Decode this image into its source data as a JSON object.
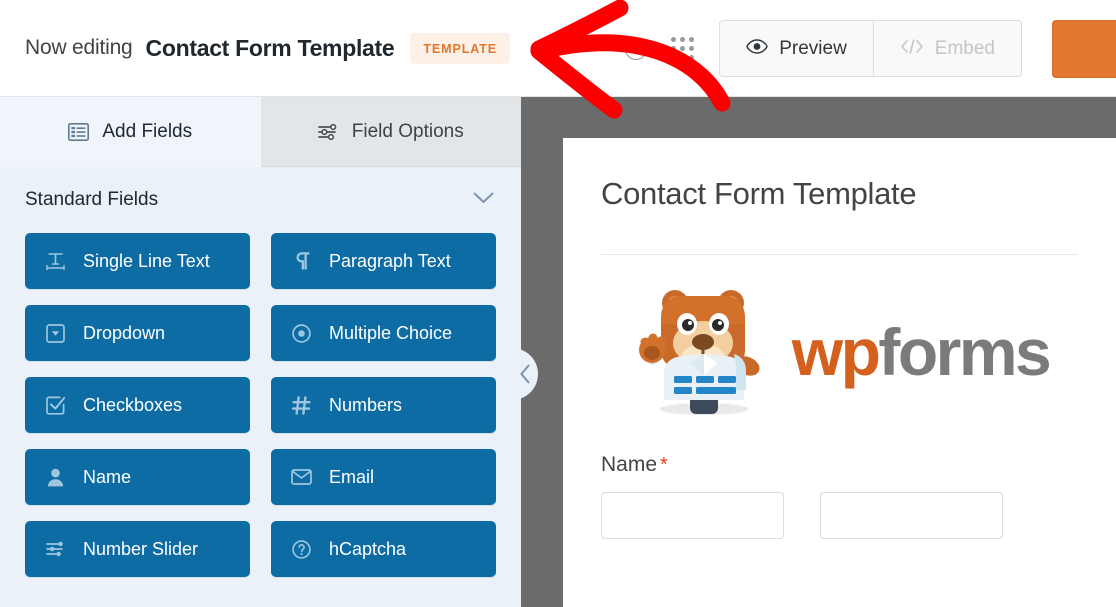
{
  "header": {
    "now_editing_label": "Now editing",
    "form_title": "Contact Form Template",
    "template_badge": "TEMPLATE",
    "help_icon": "question-mark-icon",
    "grid_icon": "grid-dots-icon",
    "preview_label": "Preview",
    "preview_icon": "eye-icon",
    "embed_label": "Embed",
    "embed_icon": "code-brackets-icon",
    "save_button_label": ""
  },
  "sidebar": {
    "tabs": [
      {
        "label": "Add Fields",
        "icon": "list-panel-icon",
        "active": true
      },
      {
        "label": "Field Options",
        "icon": "sliders-icon",
        "active": false
      }
    ],
    "section": {
      "title": "Standard Fields",
      "collapse_icon": "chevron-down-icon"
    },
    "fields": [
      {
        "label": "Single Line Text",
        "icon": "text-width-icon"
      },
      {
        "label": "Paragraph Text",
        "icon": "pilcrow-icon"
      },
      {
        "label": "Dropdown",
        "icon": "dropdown-caret-icon"
      },
      {
        "label": "Multiple Choice",
        "icon": "radio-dot-icon"
      },
      {
        "label": "Checkboxes",
        "icon": "checkbox-check-icon"
      },
      {
        "label": "Numbers",
        "icon": "hash-icon"
      },
      {
        "label": "Name",
        "icon": "user-icon"
      },
      {
        "label": "Email",
        "icon": "envelope-icon"
      },
      {
        "label": "Number Slider",
        "icon": "sliders-icon"
      },
      {
        "label": "hCaptcha",
        "icon": "question-circle-icon"
      }
    ],
    "collapse_handle_icon": "chevron-left-icon"
  },
  "preview": {
    "form_heading": "Contact Form Template",
    "logo": {
      "part1": "wp",
      "part2": "forms",
      "mascot": "beaver-mascot-icon"
    },
    "name_field": {
      "label": "Name",
      "required_marker": "*",
      "first_value": "",
      "last_value": "",
      "first_placeholder": "",
      "last_placeholder": ""
    }
  },
  "annotation": {
    "arrow": "red-arrow-pointing-left",
    "color": "#fa0000"
  },
  "colors": {
    "field_button": "#0e6ca4",
    "accent_orange": "#e27730",
    "badge_bg": "#fdf0e7",
    "sidebar_bg": "#eaf1f9",
    "canvas_gray": "#6b6b6b",
    "required_red": "#e2401c"
  }
}
